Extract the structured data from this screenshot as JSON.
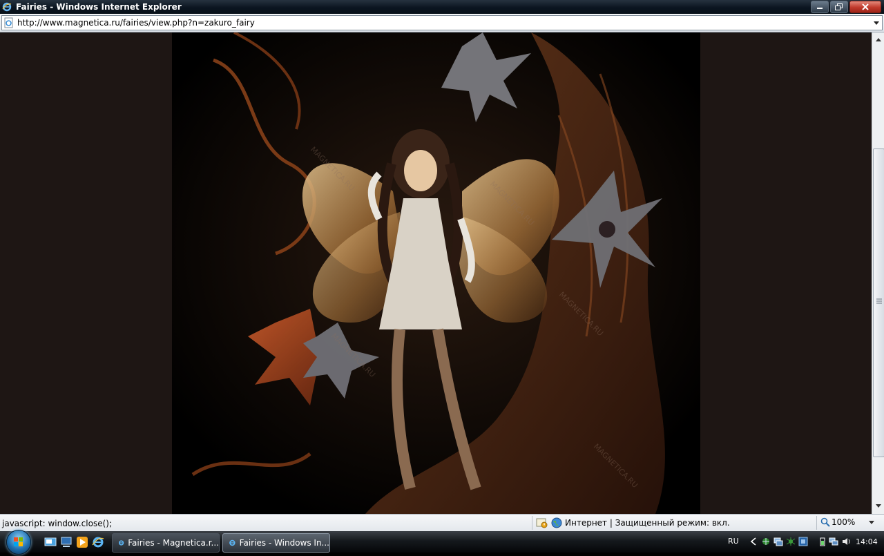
{
  "window": {
    "title": "Fairies - Windows Internet Explorer",
    "icon": "ie-icon",
    "controls": [
      "minimize-icon",
      "restore-icon",
      "close-icon"
    ]
  },
  "address_bar": {
    "url": "http://www.magnetica.ru/fairies/view.php?n=zakuro_fairy"
  },
  "content": {
    "image_subject": "fairy artwork",
    "watermark": "MAGNETICA.RU"
  },
  "status_bar": {
    "text": "javascript: window.close();",
    "zone": "Интернет | Защищенный режим: вкл.",
    "zoom": "100%"
  },
  "taskbar": {
    "quicklaunch": [
      "show-desktop-icon",
      "switch-windows-icon",
      "media-player-icon",
      "ie-icon"
    ],
    "tasks": [
      {
        "label": "Fairies - Magnetica.r..."
      },
      {
        "label": "Fairies - Windows In..."
      }
    ],
    "language": "RU",
    "clock": "14:04"
  },
  "colors": {
    "titlebar": "#0b1520",
    "page_background": "#1e1614",
    "artwork_background": "#000000",
    "accent_copper": "#9a4a22"
  }
}
